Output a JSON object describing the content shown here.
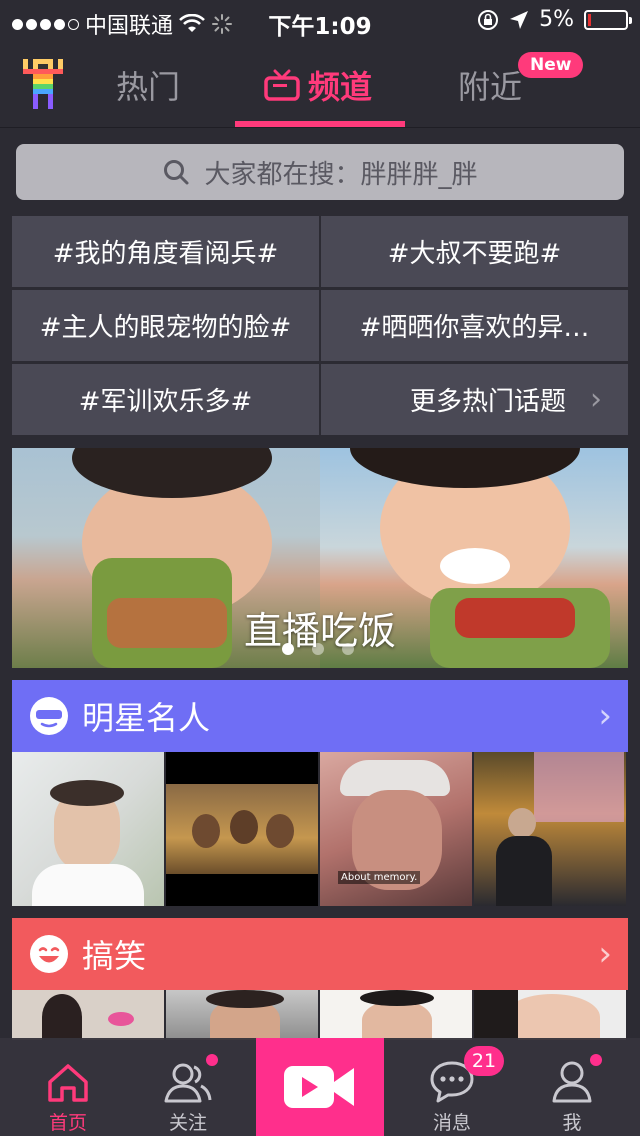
{
  "status_bar": {
    "carrier": "中国联通",
    "time": "下午1:09",
    "battery": "5%",
    "battery_level": 0.05,
    "signal_bars": 4
  },
  "header": {
    "tabs": [
      {
        "label": "热门",
        "active": false
      },
      {
        "label": "频道",
        "active": true
      },
      {
        "label": "附近",
        "active": false
      }
    ],
    "new_badge": "New"
  },
  "search": {
    "placeholder": "大家都在搜：胖胖胖_胖"
  },
  "topics": [
    "#我的角度看阅兵#",
    "#大叔不要跑#",
    "#主人的眼宠物的脸#",
    "#晒晒你喜欢的异…",
    "#军训欢乐多#"
  ],
  "topics_more": "更多热门话题",
  "banner": {
    "title": "直播吃饭",
    "pages": 3,
    "current_page": 1
  },
  "sections": [
    {
      "title": "明星名人",
      "color": "#6f6ef5",
      "icon": "sunglasses-face-icon",
      "thumb_captions": [
        "",
        "",
        "About memory.",
        ""
      ]
    },
    {
      "title": "搞笑",
      "color": "#f25a5d",
      "icon": "laughing-face-icon",
      "thumb_captions": [
        "",
        "",
        "",
        ""
      ]
    }
  ],
  "tabbar": {
    "items": [
      {
        "label": "首页",
        "icon": "home-icon",
        "active": true
      },
      {
        "label": "关注",
        "icon": "people-icon",
        "active": false
      },
      {
        "label": "",
        "icon": "video-camera-icon",
        "active": false
      },
      {
        "label": "消息",
        "icon": "chat-bubble-icon",
        "active": false
      },
      {
        "label": "我",
        "icon": "person-icon",
        "active": false
      }
    ],
    "messages_count": "21"
  },
  "colors": {
    "accent": "#ff3a7b",
    "record_button": "#ff2f8c",
    "background": "#2c2b33",
    "topic_cell": "#4a4955"
  }
}
